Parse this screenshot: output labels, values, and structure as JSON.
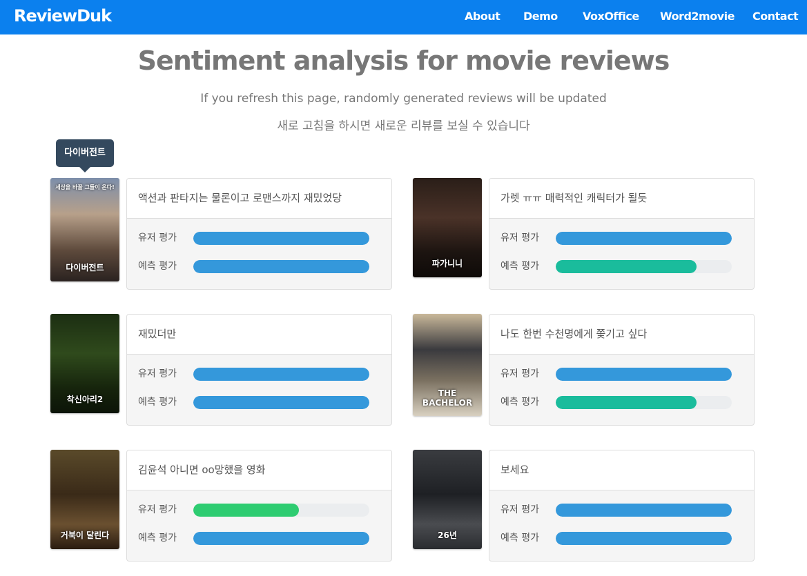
{
  "nav": {
    "brand": "ReviewDuk",
    "links": [
      "About",
      "Demo",
      "VoxOffice",
      "Word2movie",
      "Contact"
    ]
  },
  "header": {
    "title": "Sentiment analysis for movie reviews",
    "subtitle_en": "If you refresh this page, randomly generated reviews will be updated",
    "subtitle_ko": "새로 고침을 하시면 새로운 리뷰를 보실 수 있습니다"
  },
  "tooltip": "다이버전트",
  "labels": {
    "user": "유저 평가",
    "predicted": "예측 평가"
  },
  "colors": {
    "blue": "#3498db",
    "teal": "#1abc9c",
    "green": "#2ecc71",
    "nav": "#0b80ee"
  },
  "reviews": [
    {
      "review": "액션과 판타지는 물론이고 로맨스까지 재밌었당",
      "poster_title": "다이버전트",
      "poster_tagline": "세상을 바꿀 그들이 온다!",
      "user_score": 1.0,
      "user_color": "#3498db",
      "pred_score": 1.0,
      "pred_color": "#3498db"
    },
    {
      "review": "가렛 ㅠㅠ 매력적인 캐릭터가 될듯",
      "poster_title": "파가니니",
      "poster_tagline": "",
      "user_score": 1.0,
      "user_color": "#3498db",
      "pred_score": 0.8,
      "pred_color": "#1abc9c"
    },
    {
      "review": "재밌더만",
      "poster_title": "착신아리2",
      "poster_tagline": "",
      "user_score": 1.0,
      "user_color": "#3498db",
      "pred_score": 1.0,
      "pred_color": "#3498db"
    },
    {
      "review": "나도 한번 수천명에게 쫓기고 싶다",
      "poster_title": "THE BACHELOR",
      "poster_tagline": "",
      "user_score": 1.0,
      "user_color": "#3498db",
      "pred_score": 0.8,
      "pred_color": "#1abc9c"
    },
    {
      "review": "김윤석 아니면 oo망했을 영화",
      "poster_title": "거북이 달린다",
      "poster_tagline": "",
      "user_score": 0.6,
      "user_color": "#2ecc71",
      "pred_score": 1.0,
      "pred_color": "#3498db"
    },
    {
      "review": "보세요",
      "poster_title": "26년",
      "poster_tagline": "",
      "user_score": 1.0,
      "user_color": "#3498db",
      "pred_score": 1.0,
      "pred_color": "#3498db"
    }
  ]
}
